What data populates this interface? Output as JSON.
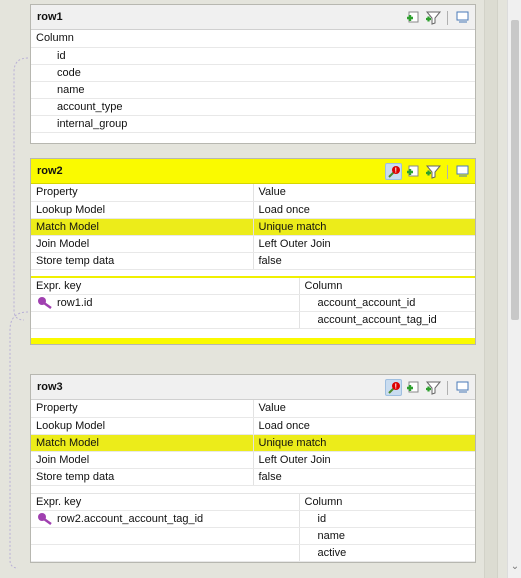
{
  "panels": [
    {
      "title": "row1",
      "column_header": "Column",
      "columns": [
        "id",
        "code",
        "name",
        "account_type",
        "internal_group"
      ]
    },
    {
      "title": "row2",
      "property_header": "Property",
      "value_header": "Value",
      "properties": [
        {
          "property": "Lookup Model",
          "value": "Load once"
        },
        {
          "property": "Match Model",
          "value": "Unique match"
        },
        {
          "property": "Join Model",
          "value": "Left Outer Join"
        },
        {
          "property": "Store temp data",
          "value": "false"
        }
      ],
      "expr_header": "Expr. key",
      "column_header": "Column",
      "keys": [
        {
          "expr": "row1.id",
          "column": "account_account_id"
        },
        {
          "expr": "",
          "column": "account_account_tag_id"
        }
      ]
    },
    {
      "title": "row3",
      "property_header": "Property",
      "value_header": "Value",
      "properties": [
        {
          "property": "Lookup Model",
          "value": "Load once"
        },
        {
          "property": "Match Model",
          "value": "Unique match"
        },
        {
          "property": "Join Model",
          "value": "Left Outer Join"
        },
        {
          "property": "Store temp data",
          "value": "false"
        }
      ],
      "expr_header": "Expr. key",
      "column_header": "Column",
      "keys": [
        {
          "expr": "row2.account_account_tag_id",
          "column": "id"
        },
        {
          "expr": "",
          "column": "name"
        },
        {
          "expr": "",
          "column": "active"
        }
      ]
    }
  ],
  "colors": {
    "highlight": "#fafa00",
    "selected_row": "#ecec1a",
    "key_icon": "#a040b0",
    "add_icon": "#2ea02e"
  },
  "icons": [
    "add-row-icon",
    "filter-icon",
    "minimize-icon",
    "key-settings-icon",
    "key-icon"
  ]
}
